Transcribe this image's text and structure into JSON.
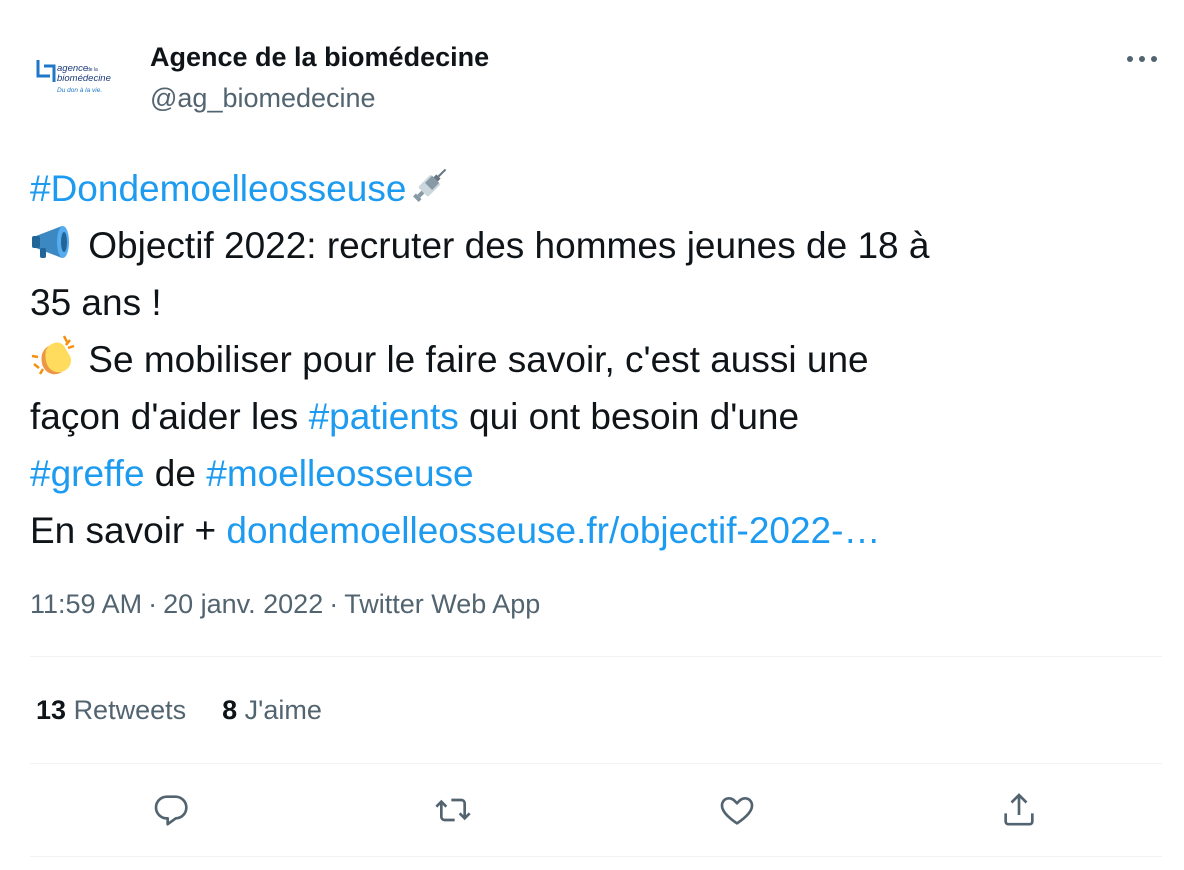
{
  "author": {
    "name": "Agence de la biomédecine",
    "handle": "@ag_biomedecine",
    "logo": {
      "line1": "agence",
      "line1_small": "de la",
      "line2": "biomédecine",
      "tagline": "Du don à la vie."
    }
  },
  "tweet": {
    "hashtag_main": "#Dondemoelleosseuse",
    "emoji_syringe": "syringe-emoji",
    "emoji_megaphone": "megaphone-emoji",
    "line2": " Objectif 2022: recruter des hommes jeunes de 18 à",
    "line3": "35 ans !",
    "emoji_clap": "clapping-hands-emoji",
    "line4": " Se mobiliser pour le faire savoir, c'est aussi une",
    "line5_a": "façon d'aider les ",
    "hashtag_patients": "#patients",
    "line5_b": " qui ont besoin d'une",
    "hashtag_greffe": "#greffe",
    "line6_mid": " de ",
    "hashtag_moelle": "#moelleosseuse",
    "line7_a": "En savoir + ",
    "link_text": "dondemoelleosseuse.fr/objectif-2022-…"
  },
  "meta": {
    "time": "11:59 AM",
    "separator": "·",
    "date": "20 janv. 2022",
    "source": "Twitter Web App"
  },
  "stats": {
    "retweets_count": "13",
    "retweets_label": "Retweets",
    "likes_count": "8",
    "likes_label": "J'aime"
  },
  "actions": [
    "reply-icon",
    "retweet-icon",
    "like-icon",
    "share-icon"
  ],
  "colors": {
    "link": "#1d9bf0",
    "text": "#0f1419",
    "secondary": "#536471",
    "divider": "#eff3f4",
    "logo_blue": "#1e77c8",
    "logo_navy": "#1b3a7a"
  }
}
